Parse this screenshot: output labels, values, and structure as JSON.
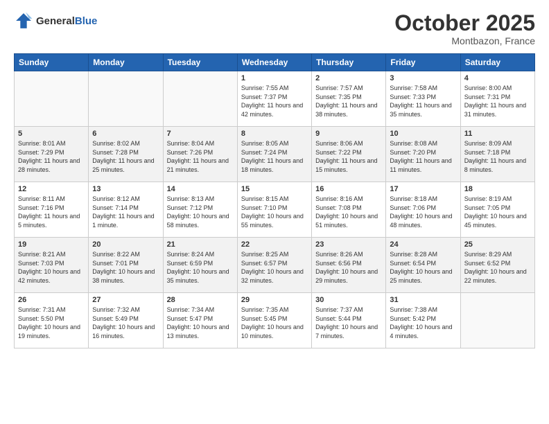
{
  "header": {
    "logo_line1": "General",
    "logo_line2": "Blue",
    "month": "October 2025",
    "location": "Montbazon, France"
  },
  "days_of_week": [
    "Sunday",
    "Monday",
    "Tuesday",
    "Wednesday",
    "Thursday",
    "Friday",
    "Saturday"
  ],
  "weeks": [
    [
      {
        "day": "",
        "sunrise": "",
        "sunset": "",
        "daylight": ""
      },
      {
        "day": "",
        "sunrise": "",
        "sunset": "",
        "daylight": ""
      },
      {
        "day": "",
        "sunrise": "",
        "sunset": "",
        "daylight": ""
      },
      {
        "day": "1",
        "sunrise": "Sunrise: 7:55 AM",
        "sunset": "Sunset: 7:37 PM",
        "daylight": "Daylight: 11 hours and 42 minutes."
      },
      {
        "day": "2",
        "sunrise": "Sunrise: 7:57 AM",
        "sunset": "Sunset: 7:35 PM",
        "daylight": "Daylight: 11 hours and 38 minutes."
      },
      {
        "day": "3",
        "sunrise": "Sunrise: 7:58 AM",
        "sunset": "Sunset: 7:33 PM",
        "daylight": "Daylight: 11 hours and 35 minutes."
      },
      {
        "day": "4",
        "sunrise": "Sunrise: 8:00 AM",
        "sunset": "Sunset: 7:31 PM",
        "daylight": "Daylight: 11 hours and 31 minutes."
      }
    ],
    [
      {
        "day": "5",
        "sunrise": "Sunrise: 8:01 AM",
        "sunset": "Sunset: 7:29 PM",
        "daylight": "Daylight: 11 hours and 28 minutes."
      },
      {
        "day": "6",
        "sunrise": "Sunrise: 8:02 AM",
        "sunset": "Sunset: 7:28 PM",
        "daylight": "Daylight: 11 hours and 25 minutes."
      },
      {
        "day": "7",
        "sunrise": "Sunrise: 8:04 AM",
        "sunset": "Sunset: 7:26 PM",
        "daylight": "Daylight: 11 hours and 21 minutes."
      },
      {
        "day": "8",
        "sunrise": "Sunrise: 8:05 AM",
        "sunset": "Sunset: 7:24 PM",
        "daylight": "Daylight: 11 hours and 18 minutes."
      },
      {
        "day": "9",
        "sunrise": "Sunrise: 8:06 AM",
        "sunset": "Sunset: 7:22 PM",
        "daylight": "Daylight: 11 hours and 15 minutes."
      },
      {
        "day": "10",
        "sunrise": "Sunrise: 8:08 AM",
        "sunset": "Sunset: 7:20 PM",
        "daylight": "Daylight: 11 hours and 11 minutes."
      },
      {
        "day": "11",
        "sunrise": "Sunrise: 8:09 AM",
        "sunset": "Sunset: 7:18 PM",
        "daylight": "Daylight: 11 hours and 8 minutes."
      }
    ],
    [
      {
        "day": "12",
        "sunrise": "Sunrise: 8:11 AM",
        "sunset": "Sunset: 7:16 PM",
        "daylight": "Daylight: 11 hours and 5 minutes."
      },
      {
        "day": "13",
        "sunrise": "Sunrise: 8:12 AM",
        "sunset": "Sunset: 7:14 PM",
        "daylight": "Daylight: 11 hours and 1 minute."
      },
      {
        "day": "14",
        "sunrise": "Sunrise: 8:13 AM",
        "sunset": "Sunset: 7:12 PM",
        "daylight": "Daylight: 10 hours and 58 minutes."
      },
      {
        "day": "15",
        "sunrise": "Sunrise: 8:15 AM",
        "sunset": "Sunset: 7:10 PM",
        "daylight": "Daylight: 10 hours and 55 minutes."
      },
      {
        "day": "16",
        "sunrise": "Sunrise: 8:16 AM",
        "sunset": "Sunset: 7:08 PM",
        "daylight": "Daylight: 10 hours and 51 minutes."
      },
      {
        "day": "17",
        "sunrise": "Sunrise: 8:18 AM",
        "sunset": "Sunset: 7:06 PM",
        "daylight": "Daylight: 10 hours and 48 minutes."
      },
      {
        "day": "18",
        "sunrise": "Sunrise: 8:19 AM",
        "sunset": "Sunset: 7:05 PM",
        "daylight": "Daylight: 10 hours and 45 minutes."
      }
    ],
    [
      {
        "day": "19",
        "sunrise": "Sunrise: 8:21 AM",
        "sunset": "Sunset: 7:03 PM",
        "daylight": "Daylight: 10 hours and 42 minutes."
      },
      {
        "day": "20",
        "sunrise": "Sunrise: 8:22 AM",
        "sunset": "Sunset: 7:01 PM",
        "daylight": "Daylight: 10 hours and 38 minutes."
      },
      {
        "day": "21",
        "sunrise": "Sunrise: 8:24 AM",
        "sunset": "Sunset: 6:59 PM",
        "daylight": "Daylight: 10 hours and 35 minutes."
      },
      {
        "day": "22",
        "sunrise": "Sunrise: 8:25 AM",
        "sunset": "Sunset: 6:57 PM",
        "daylight": "Daylight: 10 hours and 32 minutes."
      },
      {
        "day": "23",
        "sunrise": "Sunrise: 8:26 AM",
        "sunset": "Sunset: 6:56 PM",
        "daylight": "Daylight: 10 hours and 29 minutes."
      },
      {
        "day": "24",
        "sunrise": "Sunrise: 8:28 AM",
        "sunset": "Sunset: 6:54 PM",
        "daylight": "Daylight: 10 hours and 25 minutes."
      },
      {
        "day": "25",
        "sunrise": "Sunrise: 8:29 AM",
        "sunset": "Sunset: 6:52 PM",
        "daylight": "Daylight: 10 hours and 22 minutes."
      }
    ],
    [
      {
        "day": "26",
        "sunrise": "Sunrise: 7:31 AM",
        "sunset": "Sunset: 5:50 PM",
        "daylight": "Daylight: 10 hours and 19 minutes."
      },
      {
        "day": "27",
        "sunrise": "Sunrise: 7:32 AM",
        "sunset": "Sunset: 5:49 PM",
        "daylight": "Daylight: 10 hours and 16 minutes."
      },
      {
        "day": "28",
        "sunrise": "Sunrise: 7:34 AM",
        "sunset": "Sunset: 5:47 PM",
        "daylight": "Daylight: 10 hours and 13 minutes."
      },
      {
        "day": "29",
        "sunrise": "Sunrise: 7:35 AM",
        "sunset": "Sunset: 5:45 PM",
        "daylight": "Daylight: 10 hours and 10 minutes."
      },
      {
        "day": "30",
        "sunrise": "Sunrise: 7:37 AM",
        "sunset": "Sunset: 5:44 PM",
        "daylight": "Daylight: 10 hours and 7 minutes."
      },
      {
        "day": "31",
        "sunrise": "Sunrise: 7:38 AM",
        "sunset": "Sunset: 5:42 PM",
        "daylight": "Daylight: 10 hours and 4 minutes."
      },
      {
        "day": "",
        "sunrise": "",
        "sunset": "",
        "daylight": ""
      }
    ]
  ]
}
